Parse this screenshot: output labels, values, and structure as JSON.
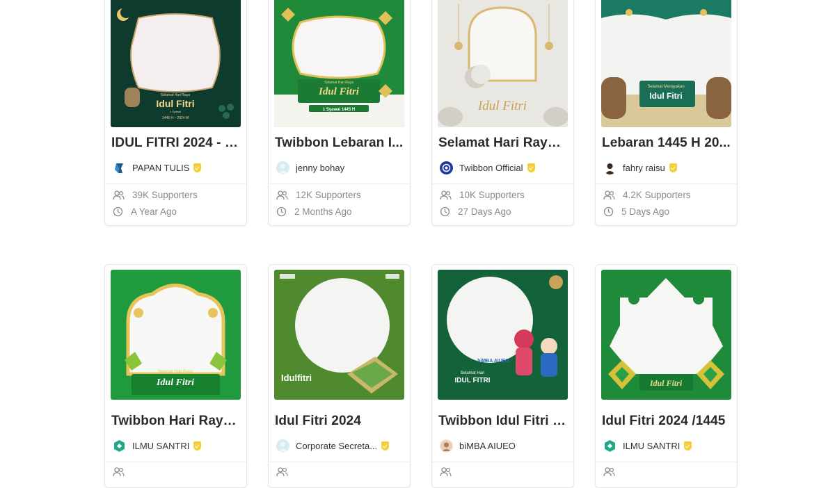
{
  "cards": [
    {
      "title": "IDUL FITRI 2024 - 1...",
      "author": "PAPAN TULIS",
      "verified": true,
      "supporters": "39K Supporters",
      "time": "A Year Ago",
      "theme": "dark-green"
    },
    {
      "title": "Twibbon Lebaran I...",
      "author": "jenny bohay",
      "verified": false,
      "supporters": "12K Supporters",
      "time": "2 Months Ago",
      "theme": "green-gold"
    },
    {
      "title": "Selamat Hari Raya I...",
      "author": "Twibbon Official",
      "verified": true,
      "supporters": "10K Supporters",
      "time": "27 Days Ago",
      "theme": "white-gold"
    },
    {
      "title": "Lebaran 1445 H 20...",
      "author": "fahry raisu",
      "verified": true,
      "supporters": "4.2K Supporters",
      "time": "5 Days Ago",
      "theme": "teal-gold"
    },
    {
      "title": "Twibbon Hari Raya ...",
      "author": "ILMU SANTRI",
      "verified": true,
      "supporters": "",
      "time": "",
      "theme": "bright-green"
    },
    {
      "title": "Idul Fitri 2024",
      "author": "Corporate Secreta...",
      "verified": true,
      "supporters": "",
      "time": "",
      "theme": "olive-green"
    },
    {
      "title": "Twibbon Idul Fitri 2...",
      "author": "biMBA AIUEO",
      "verified": false,
      "supporters": "",
      "time": "",
      "theme": "dark-green-kids"
    },
    {
      "title": "Idul Fitri 2024 /1445",
      "author": "ILMU SANTRI",
      "verified": true,
      "supporters": "",
      "time": "",
      "theme": "green-ketupat"
    }
  ],
  "thumb_text": {
    "c1": [
      "Selamat Hari Raya",
      "Idul Fitri",
      "1 Syawal",
      "1445 H – 2024 M"
    ],
    "c2": [
      "Selamat Hari Raya",
      "Idul Fitri",
      "1 Syawal 1445 H"
    ],
    "c3": [
      "Idul Fitri"
    ],
    "c4": [
      "Selamat Merayakan",
      "Idul Fitri"
    ],
    "c5": [
      "Selamat Hari Raya",
      "Idul Fitri"
    ],
    "c6": [
      "Idulfitri"
    ],
    "c7": [
      "Selamat Hari",
      "IDUL FITRI",
      "biMBA AIUEO"
    ],
    "c8": [
      "Idul Fitri"
    ]
  },
  "colors": {
    "verified": "#f4cf3a",
    "muted": "#8a8a8a",
    "border": "#e6e6e6"
  }
}
